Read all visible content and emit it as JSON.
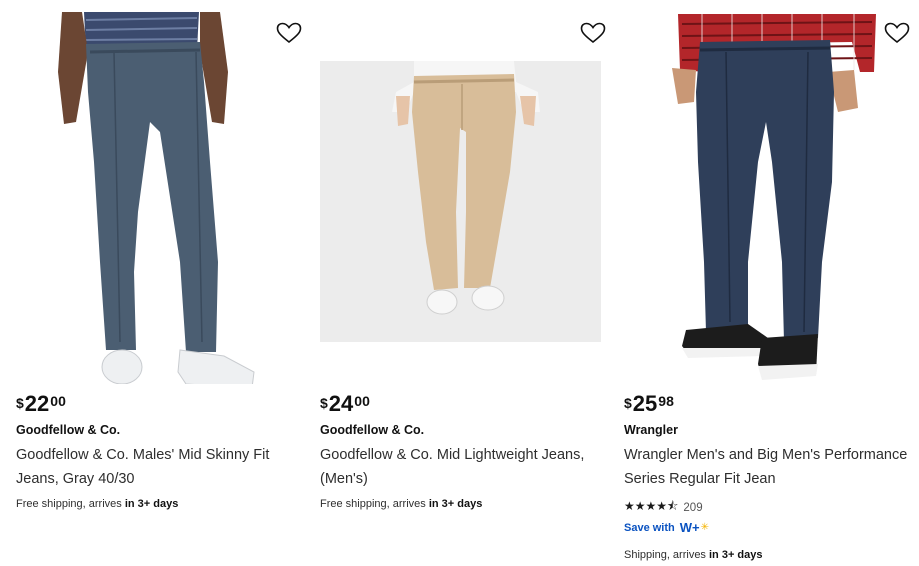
{
  "products": [
    {
      "price": {
        "currency": "$",
        "dollars": "22",
        "cents": "00"
      },
      "brand": "Goodfellow & Co.",
      "title": "Goodfellow & Co. Males' Mid Skinny Fit Jeans, Gray 40/30",
      "shipping": {
        "prefix": "Free shipping, arrives ",
        "bold": "in 3+ days"
      },
      "image_icon": "gray-skinny-jeans-photo",
      "favorite_icon": "heart-outline-icon"
    },
    {
      "price": {
        "currency": "$",
        "dollars": "24",
        "cents": "00"
      },
      "brand": "Goodfellow & Co.",
      "title": "Goodfellow & Co. Mid Lightweight Jeans, (Men's)",
      "shipping": {
        "prefix": "Free shipping, arrives ",
        "bold": "in 3+ days"
      },
      "image_icon": "khaki-jeans-photo",
      "favorite_icon": "heart-outline-icon"
    },
    {
      "price": {
        "currency": "$",
        "dollars": "25",
        "cents": "98"
      },
      "brand": "Wrangler",
      "title": "Wrangler Men's and Big Men's Performance Series Regular Fit Jean",
      "rating": {
        "stars": 4.5,
        "stars_display": "★★★★⯪",
        "count": "209"
      },
      "save_with": "Save with",
      "wplus": "W+",
      "shipping": {
        "prefix": "Shipping, arrives ",
        "bold": "in 3+ days"
      },
      "image_icon": "dark-denim-jeans-photo",
      "favorite_icon": "heart-outline-icon"
    }
  ],
  "colors": {
    "accent_blue": "#0b53c1",
    "spark_yellow": "#f5b400",
    "text": "#2e2e2e"
  }
}
